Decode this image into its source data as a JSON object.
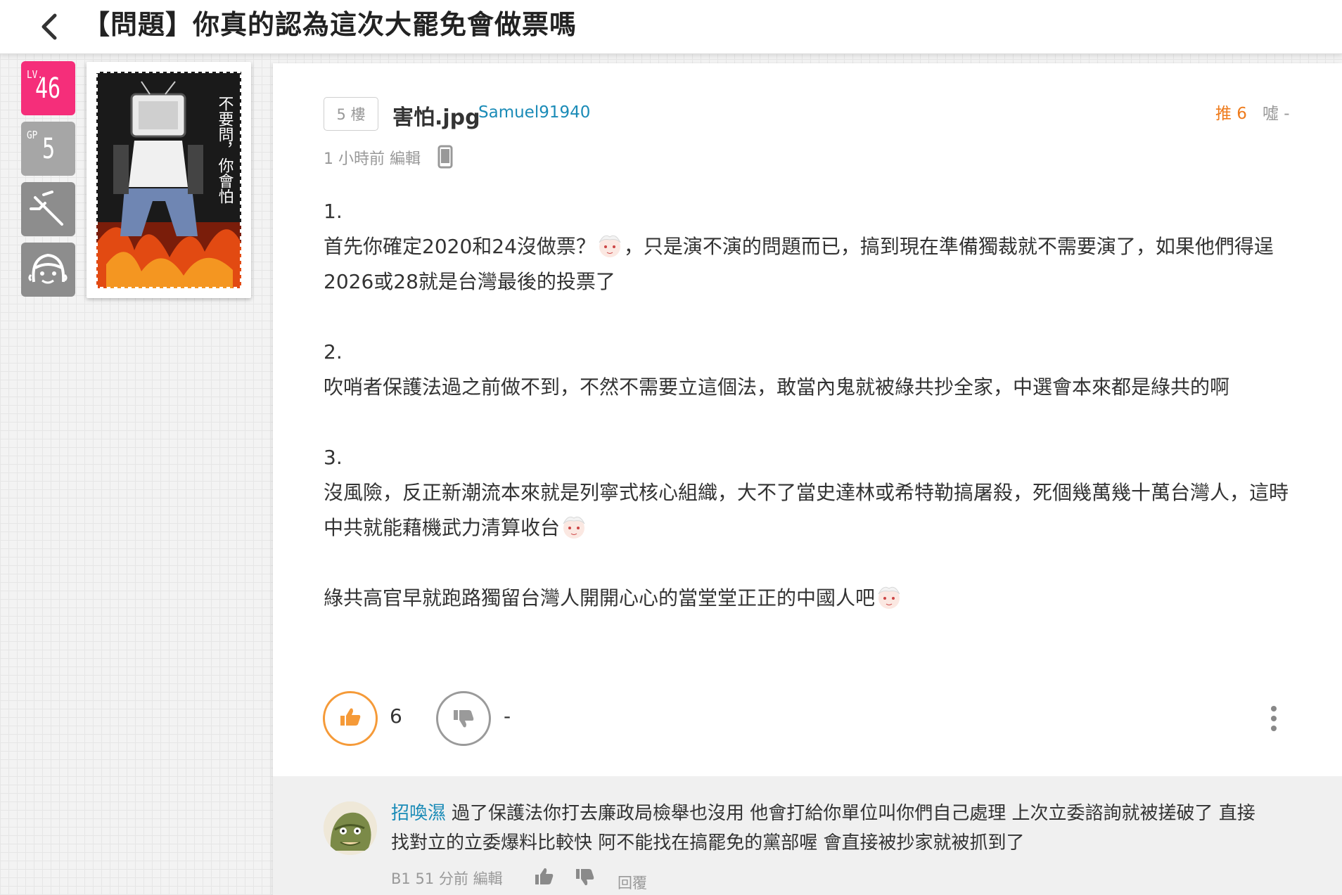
{
  "header": {
    "title": "【問題】你真的認為這次大罷免會做票嗎"
  },
  "sidebar": {
    "level_prefix": "LV.",
    "level_value": "46",
    "gp_prefix": "GP",
    "gp_value": "5",
    "avatar_caption": "不要問，你會怕"
  },
  "post": {
    "floor": "5 樓",
    "title": "害怕.jpg",
    "author": "Samuel91940",
    "time": "1 小時前",
    "edit_label": "編輯",
    "push_label": "推 6",
    "boo_label": "噓 -",
    "paragraphs": {
      "p1_num": "1.",
      "p1_a": "首先你確定2020和24沒做票？",
      "p1_b": "，只是演不演的問題而已，搞到現在準備獨裁就不需要演了，如果他們得逞2026或28就是台灣最後的投票了",
      "p2_num": "2.",
      "p2_text": "吹哨者保護法過之前做不到，不然不需要立這個法，敢當內鬼就被綠共抄全家，中選會本來都是綠共的啊",
      "p3_num": "3.",
      "p3_text": "沒風險，反正新潮流本來就是列寧式核心組織，大不了當史達林或希特勒搞屠殺，死個幾萬幾十萬台灣人，這時中共就能藉機武力清算收台",
      "p4_text": "綠共高官早就跑路獨留台灣人開開心心的當堂堂正正的中國人吧"
    },
    "like_count": "6",
    "dislike_count": "-"
  },
  "comment": {
    "user": "招喚濕",
    "text": "過了保護法你打去廉政局檢舉也沒用 他會打給你單位叫你們自己處理 上次立委諮詢就被搓破了 直接找對立的立委爆料比較快 阿不能找在搞罷免的黨部喔 會直接被抄家就被抓到了",
    "floor": "B1",
    "time": "51 分前",
    "edit_label": "編輯",
    "reply_label": "回覆"
  },
  "colors": {
    "accent_orange": "#f59a38",
    "level_pink": "#f52e7a",
    "link_blue": "#1a8bb7"
  }
}
